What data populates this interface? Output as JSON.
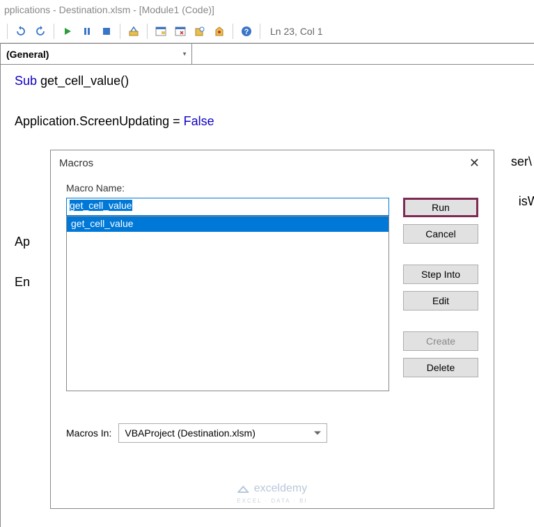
{
  "titlebar": "pplications - Destination.xlsm - [Module1 (Code)]",
  "cursor_pos": "Ln 23, Col 1",
  "dropdown": {
    "left": "(General)"
  },
  "code": {
    "l1a": "Sub",
    "l1b": " get_cell_value()",
    "l2a": "Application.ScreenUpdating = ",
    "l2b": "False",
    "l3": "ser\\",
    "l4": "isWo",
    "l5": "Ap",
    "l6": "En"
  },
  "dialog": {
    "title": "Macros",
    "label": "Macro Name:",
    "input_value": "get_cell_value",
    "list": [
      "get_cell_value"
    ],
    "buttons": {
      "run": "Run",
      "cancel": "Cancel",
      "stepinto": "Step Into",
      "edit": "Edit",
      "create": "Create",
      "delete": "Delete"
    },
    "macros_in_label": "Macros In:",
    "macros_in_value": "VBAProject (Destination.xlsm)"
  },
  "watermark": {
    "brand": "exceldemy",
    "tag": "EXCEL · DATA · BI"
  }
}
